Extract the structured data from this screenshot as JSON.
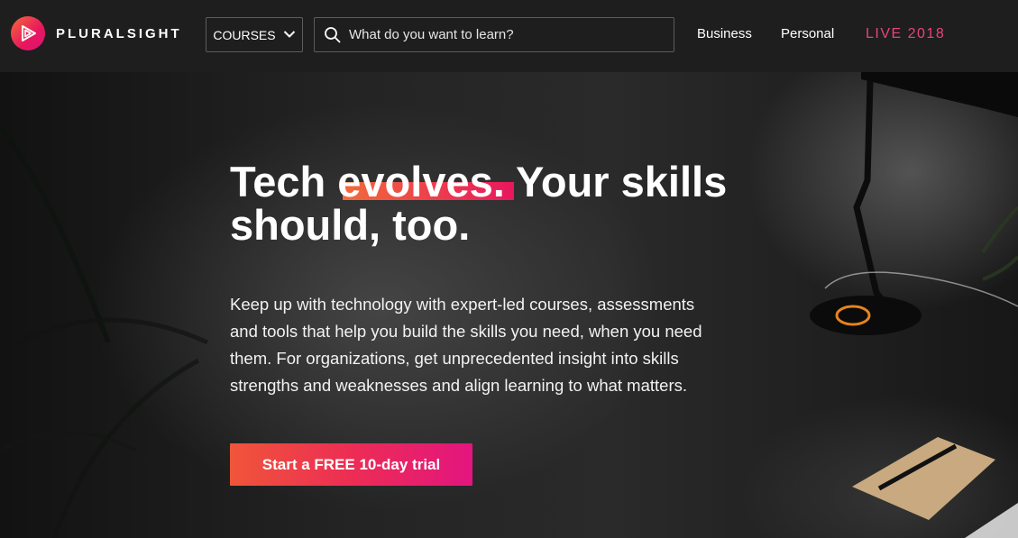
{
  "nav": {
    "logo_text": "PLURALSIGHT",
    "courses_label": "COURSES",
    "search_placeholder": "What do you want to learn?",
    "links": {
      "business": "Business",
      "personal": "Personal",
      "live": "LIVE 2018"
    }
  },
  "hero": {
    "headline_part1": "Tech ",
    "headline_highlight": "evolves.",
    "headline_part2": " Your skills should, too.",
    "lead": "Keep up with technology with expert-led courses, assessments and tools that help you build the skills you need, when you need them. For organizations, get unprecedented insight into skills strengths and weaknesses and align learning to what matters.",
    "cta_label": "Start a FREE 10-day trial"
  },
  "colors": {
    "brand_orange": "#f26b3a",
    "brand_pink": "#e8175d",
    "live_pink": "#e8447a",
    "nav_bg": "#1e1e1e"
  },
  "icons": {
    "logo": "play-triangle-logo-icon",
    "courses": "chevron-down-icon",
    "search": "search-icon"
  }
}
